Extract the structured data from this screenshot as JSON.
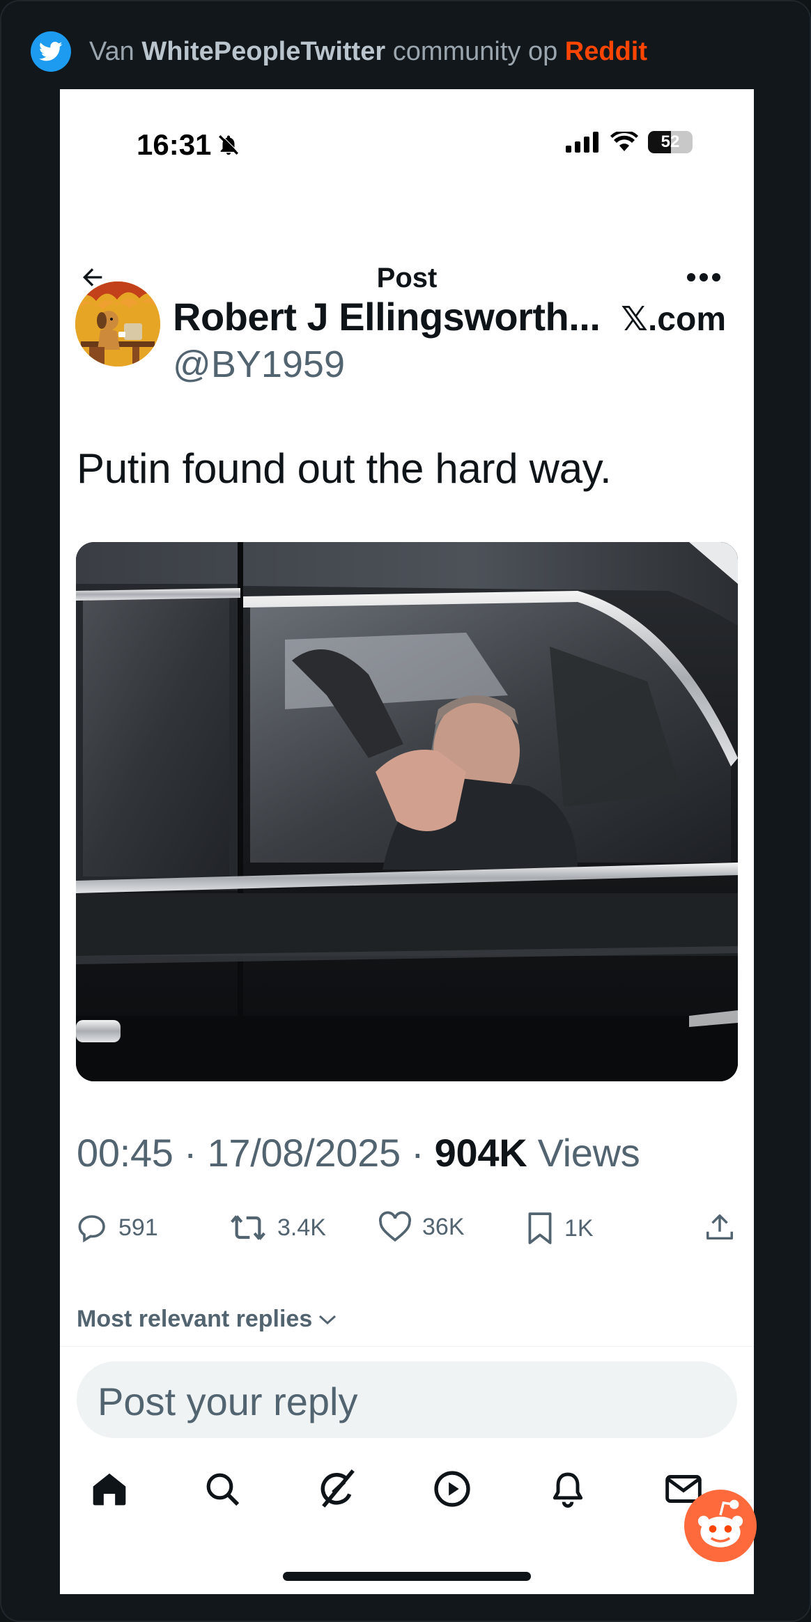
{
  "source": {
    "prefix": "Van",
    "community": "WhitePeopleTwitter",
    "middle": "community op",
    "platform": "Reddit"
  },
  "status_bar": {
    "time": "16:31",
    "battery": "52",
    "battery_level": 0.52
  },
  "nav": {
    "title": "Post"
  },
  "author": {
    "name": "Robert J Ellingsworth...",
    "handle": "@BY1959",
    "site": "𝕏.com"
  },
  "tweet": {
    "text": "Putin found out the hard way."
  },
  "meta": {
    "time": "00:45",
    "sep1": " · ",
    "date": "17/08/2025",
    "sep2": " · ",
    "views_count": "904K",
    "views_label": " Views"
  },
  "actions": {
    "replies": "591",
    "reposts": "3.4K",
    "likes": "36K",
    "bookmarks": "1K"
  },
  "replies_sort": {
    "label": "Most relevant replies"
  },
  "reply_box": {
    "placeholder": "Post your reply"
  },
  "colors": {
    "twitter_blue": "#1d9bf0",
    "reddit_orange": "#ff4500",
    "text_primary": "#0f1419",
    "text_secondary": "#536471"
  }
}
